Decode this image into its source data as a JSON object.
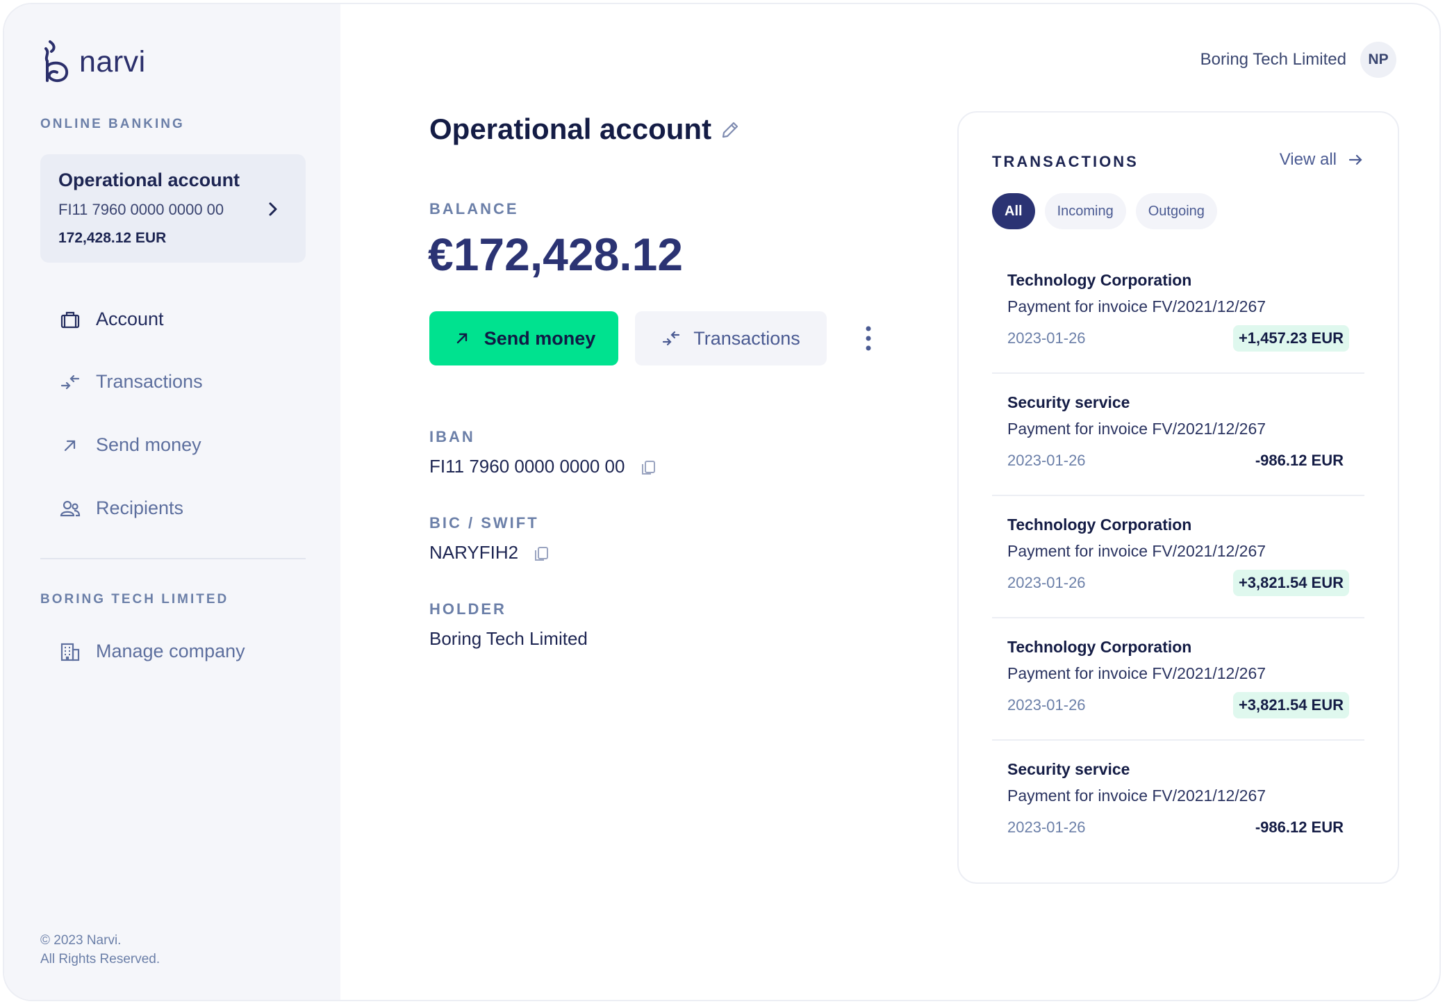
{
  "brand": {
    "name": "narvi"
  },
  "sidebar": {
    "section_label": "ONLINE BANKING",
    "account_card": {
      "name": "Operational account",
      "iban": "FI11 7960 0000 0000 00",
      "amount": "172,428.12 EUR"
    },
    "nav": [
      {
        "label": "Account",
        "icon": "briefcase-icon"
      },
      {
        "label": "Transactions",
        "icon": "transfer-arrows-icon"
      },
      {
        "label": "Send money",
        "icon": "arrow-up-right-icon"
      },
      {
        "label": "Recipients",
        "icon": "recipients-icon"
      }
    ],
    "company_section_label": "BORING TECH LIMITED",
    "company_nav": [
      {
        "label": "Manage company",
        "icon": "building-icon"
      }
    ],
    "footer": {
      "line1": "© 2023 Narvi.",
      "line2": "All Rights Reserved."
    }
  },
  "header": {
    "company_name": "Boring Tech Limited",
    "avatar_initials": "NP"
  },
  "main": {
    "title": "Operational account",
    "balance_label": "BALANCE",
    "balance": "€172,428.12",
    "send_money_label": "Send money",
    "transactions_label": "Transactions",
    "iban_label": "IBAN",
    "iban": "FI11 7960 0000 0000 00",
    "bic_label": "BIC / SWIFT",
    "bic": "NARYFIH2",
    "holder_label": "HOLDER",
    "holder": "Boring Tech Limited"
  },
  "transactions": {
    "title": "TRANSACTIONS",
    "view_all": "View all",
    "filters": [
      "All",
      "Incoming",
      "Outgoing"
    ],
    "items": [
      {
        "name": "Technology Corporation",
        "description": "Payment for invoice FV/2021/12/267",
        "date": "2023-01-26",
        "amount": "+1,457.23 EUR"
      },
      {
        "name": "Security service",
        "description": "Payment for invoice FV/2021/12/267",
        "date": "2023-01-26",
        "amount": "-986.12 EUR"
      },
      {
        "name": "Technology Corporation",
        "description": "Payment for invoice FV/2021/12/267",
        "date": "2023-01-26",
        "amount": "+3,821.54 EUR"
      },
      {
        "name": "Technology Corporation",
        "description": "Payment for invoice FV/2021/12/267",
        "date": "2023-01-26",
        "amount": "+3,821.54 EUR"
      },
      {
        "name": "Security service",
        "description": "Payment for invoice FV/2021/12/267",
        "date": "2023-01-26",
        "amount": "-986.12 EUR"
      }
    ]
  },
  "colors": {
    "accent_green": "#00e28f",
    "brand_navy": "#2b3373",
    "positive_bg": "#dff8ee"
  }
}
